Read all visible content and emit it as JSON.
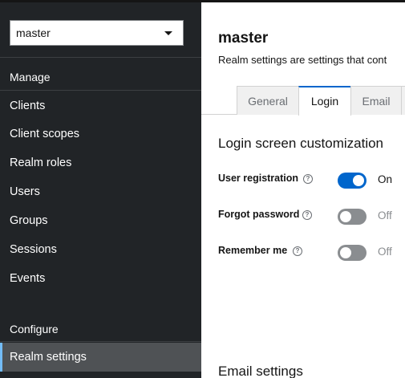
{
  "sidebar": {
    "realm_selector": {
      "value": "master"
    },
    "sections": [
      {
        "label": "Manage"
      },
      {
        "label": "Configure"
      }
    ],
    "items": [
      {
        "label": "Clients"
      },
      {
        "label": "Client scopes"
      },
      {
        "label": "Realm roles"
      },
      {
        "label": "Users"
      },
      {
        "label": "Groups"
      },
      {
        "label": "Sessions"
      },
      {
        "label": "Events"
      },
      {
        "label": "Realm settings",
        "active": true
      }
    ]
  },
  "main": {
    "title": "master",
    "description": "Realm settings are settings that cont",
    "tabs": [
      {
        "label": "General"
      },
      {
        "label": "Login",
        "active": true
      },
      {
        "label": "Email"
      }
    ],
    "login_section": {
      "title": "Login screen customization",
      "settings": [
        {
          "label": "User registration",
          "state": "On",
          "enabled": true
        },
        {
          "label": "Forgot password",
          "state": "Off",
          "enabled": false
        },
        {
          "label": "Remember me",
          "state": "Off",
          "enabled": false
        }
      ]
    },
    "email_section": {
      "title": "Email settings"
    }
  },
  "colors": {
    "sidebar_bg": "#212427",
    "active_nav_bg": "#4f5255",
    "accent": "#0066cc",
    "switch_off": "#8a8d90"
  },
  "icons": {
    "realm_caret": "caret-down-icon",
    "help": "question-circle-icon"
  }
}
